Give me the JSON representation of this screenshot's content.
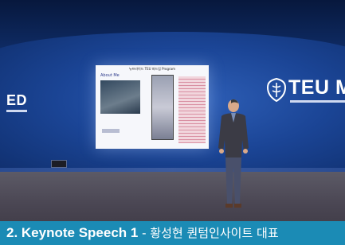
{
  "photo": {
    "slide_header": "뉴프라이드 TEU 퍼드업 Program",
    "slide_heading": "About Me",
    "left_logo_text": "ED",
    "right_logo_text": "TEU ME"
  },
  "caption": {
    "bold_text": "2. Keynote Speech 1",
    "separator": " - ",
    "rest_text": "황성현 퀀텀인사이트 대표",
    "background_color": "#1b8bb5"
  }
}
